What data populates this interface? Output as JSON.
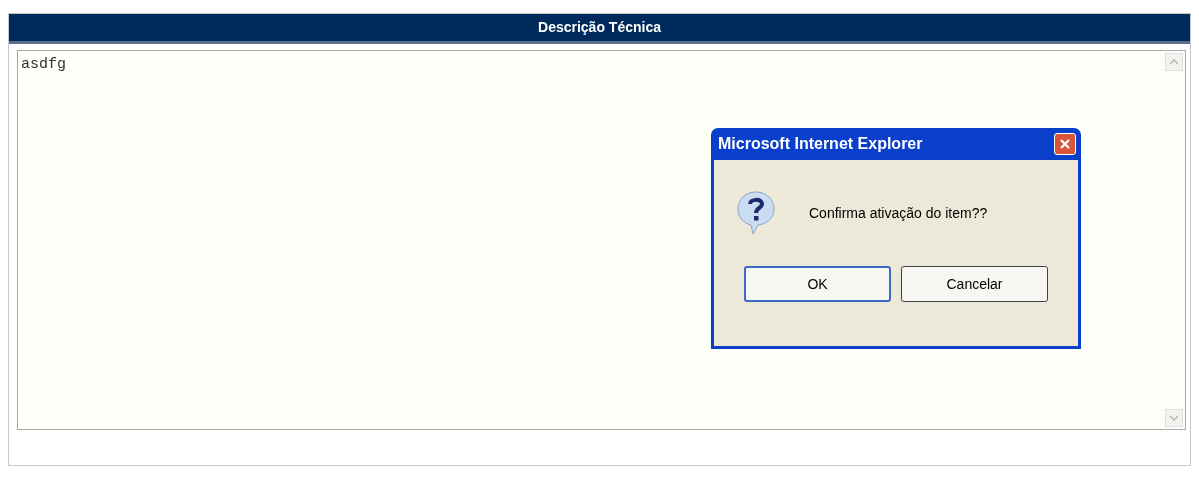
{
  "panel": {
    "title": "Descrição Técnica",
    "textarea": {
      "value": "asdfg"
    }
  },
  "dialog": {
    "title": "Microsoft Internet Explorer",
    "message": "Confirma ativação do item??",
    "buttons": [
      {
        "label": "OK",
        "focused": true
      },
      {
        "label": "Cancelar",
        "focused": false
      }
    ]
  }
}
